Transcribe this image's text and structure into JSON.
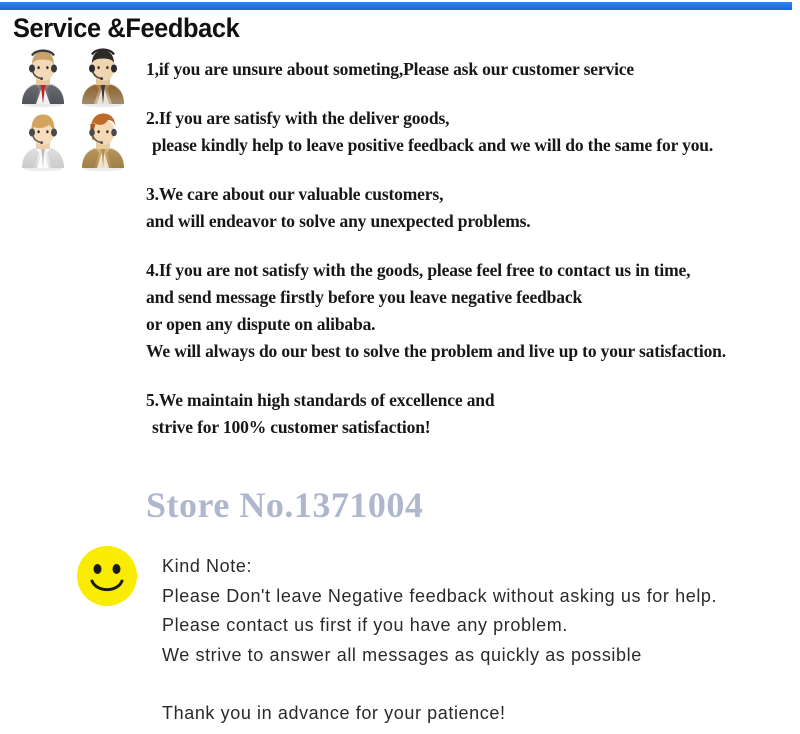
{
  "banner": {
    "rule_color": "#1976e8"
  },
  "header": {
    "title": "Service &Feedback"
  },
  "avatars": {
    "alt_label": "customer-service-agents",
    "items": [
      {
        "name": "agent-male-gray-suit",
        "suit": "#6e7175",
        "suit_dark": "#4a4d51",
        "shirt": "#f2f2f2",
        "tie": "#cc1f21",
        "hair": "#caa36c",
        "skin": "#f2d9b7"
      },
      {
        "name": "agent-male-brown-suit",
        "suit": "#9a6a2f",
        "suit_dark": "#7a5122",
        "shirt": "#e9e2d4",
        "tie": "#3a3a38",
        "hair": "#2e2a26",
        "skin": "#f0d6b0"
      },
      {
        "name": "agent-female-white-coat",
        "suit": "#e8e8e8",
        "suit_dark": "#c4c4c4",
        "shirt": "#fbfbfb",
        "tie": "#b9bcc0",
        "hair": "#d2a45e",
        "skin": "#f5ddbd"
      },
      {
        "name": "agent-female-tan-jacket",
        "suit": "#c6a063",
        "suit_dark": "#a8854c",
        "shirt": "#efe4cd",
        "tie": "#b08f52",
        "hair": "#c06a27",
        "skin": "#f3d9b6"
      }
    ]
  },
  "content": {
    "paragraphs": [
      {
        "id": "item-1",
        "lines": [
          {
            "text": "1,if you are unsure about someting,Please ask our customer service",
            "indent": false
          }
        ]
      },
      {
        "id": "item-2",
        "lines": [
          {
            "text": "2.If you are satisfy with the deliver goods,",
            "indent": false
          },
          {
            "text": "please kindly help to leave positive feedback and we will do the same for you.",
            "indent": true
          }
        ]
      },
      {
        "id": "item-3",
        "lines": [
          {
            "text": "3.We care about our valuable customers,",
            "indent": false
          },
          {
            "text": "and will endeavor to solve any unexpected problems.",
            "indent": false
          }
        ]
      },
      {
        "id": "item-4",
        "lines": [
          {
            "text": "4.If you are not satisfy with the goods, please feel free to contact us in time,",
            "indent": false
          },
          {
            "text": "and send message firstly before you leave negative feedback",
            "indent": false
          },
          {
            "text": "or open any dispute on alibaba.",
            "indent": false
          },
          {
            "text": "We will always do our best to solve the problem and live up to your satisfaction.",
            "indent": false
          }
        ]
      },
      {
        "id": "item-5",
        "lines": [
          {
            "text": "5.We maintain high standards of excellence and",
            "indent": false
          },
          {
            "text": "strive for 100% customer satisfaction!",
            "indent": true
          }
        ]
      }
    ]
  },
  "watermark": {
    "text": "Store No.1371004",
    "color": "#a9b1ca"
  },
  "smiley": {
    "name": "smiley-face-icon",
    "face_color": "#f9ec00",
    "feature_color": "#1a1a1a"
  },
  "note": {
    "lines": [
      {
        "text": "Kind Note:",
        "gap_after": false
      },
      {
        "text": "Please Don't leave Negative feedback without asking us for help.",
        "gap_after": false
      },
      {
        "text": "Please contact us first if you have any problem.",
        "gap_after": false
      },
      {
        "text": "We strive to answer all messages as quickly as possible",
        "gap_after": true
      },
      {
        "text": "Thank you in advance for your patience!",
        "gap_after": false
      }
    ]
  }
}
